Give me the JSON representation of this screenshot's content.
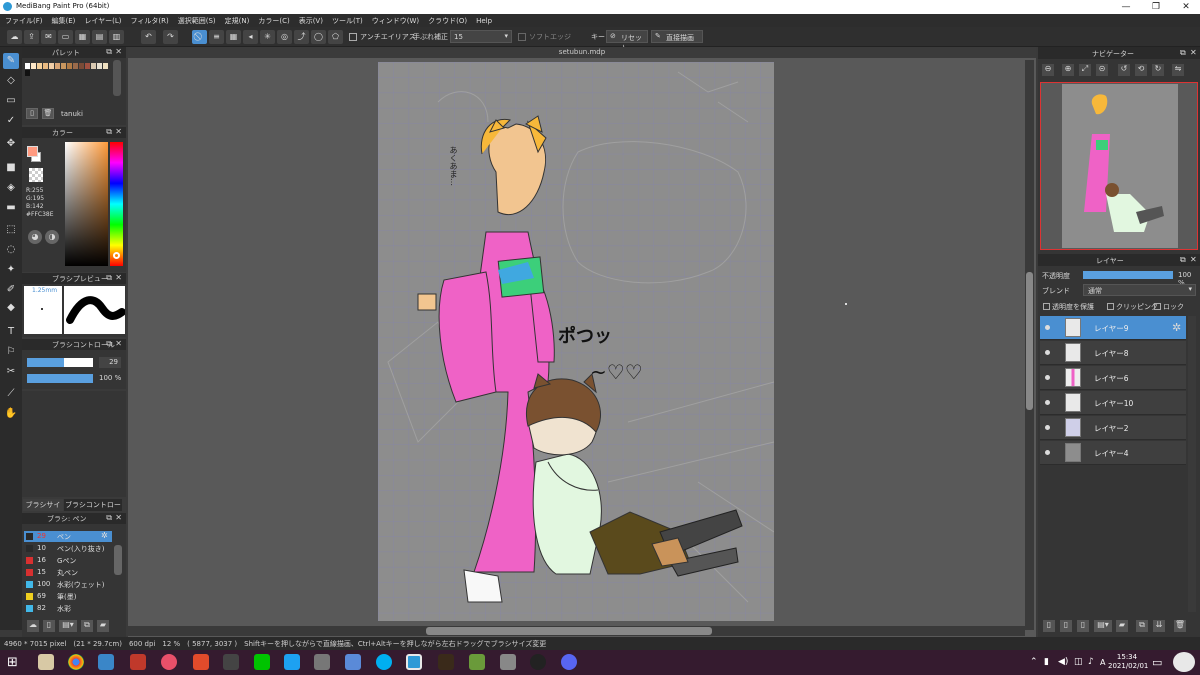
{
  "window": {
    "title": "MediBang Paint Pro (64bit)",
    "min": "—",
    "max": "❐",
    "close": "✕"
  },
  "menu": [
    "ファイル(F)",
    "編集(E)",
    "レイヤー(L)",
    "フィルタ(R)",
    "選択範囲(S)",
    "定規(N)",
    "カラー(C)",
    "表示(V)",
    "ツール(T)",
    "ウィンドウ(W)",
    "クラウド(O)",
    "Help"
  ],
  "toolbar": {
    "antialias": "アンチエイリアス",
    "stabilizer_label": "手ぶれ補正",
    "stabilizer_value": "15",
    "soft_edge": "ソフトエッジ",
    "key_label": "キー",
    "reset": "リセット",
    "direct_draw": "直接描画"
  },
  "document": {
    "tab": "setubun.mdp"
  },
  "panels": {
    "palette": {
      "title": "パレット",
      "name": "tanuki"
    },
    "color": {
      "title": "カラー",
      "r": "R:255",
      "g": "G:195",
      "b": "B:142",
      "hex": "#FFC38E"
    },
    "brush_preview": {
      "title": "ブラシプレビュー",
      "size": "1.25mm"
    },
    "brush_control": {
      "title": "ブラシコントロール",
      "size_value": "29",
      "opacity_value": "100 %"
    },
    "brush_tabs": [
      "ブラシサイズ",
      "ブラシコントロール"
    ],
    "brush_list": {
      "title": "ブラシ: ペン",
      "items": [
        {
          "size": "29",
          "name": "ペン",
          "color": "#2a2a2a",
          "selected": true
        },
        {
          "size": "10",
          "name": "ペン(入り抜き)",
          "color": "#2a2a2a"
        },
        {
          "size": "16",
          "name": "Gペン",
          "color": "#d83030"
        },
        {
          "size": "15",
          "name": "丸ペン",
          "color": "#d83030"
        },
        {
          "size": "100",
          "name": "水彩(ウェット)",
          "color": "#42b8e8"
        },
        {
          "size": "69",
          "name": "筆(墨)",
          "color": "#f0d020"
        },
        {
          "size": "82",
          "name": "水彩",
          "color": "#42b8e8"
        }
      ]
    },
    "navigator": {
      "title": "ナビゲーター"
    },
    "layer": {
      "title": "レイヤー",
      "opacity_label": "不透明度",
      "opacity_value": "100 %",
      "blend_label": "ブレンド",
      "blend_value": "通常",
      "protect": "透明度を保護",
      "clipping": "クリッピング",
      "lock": "ロック",
      "layers": [
        {
          "name": "レイヤー9",
          "selected": true
        },
        {
          "name": "レイヤー8"
        },
        {
          "name": "レイヤー6"
        },
        {
          "name": "レイヤー10"
        },
        {
          "name": "レイヤー2"
        },
        {
          "name": "レイヤー4"
        }
      ]
    }
  },
  "status": {
    "text": "4960 * 7015 pixel　(21 * 29.7cm)　600 dpi　12 %　( 5877, 3037 )　Shiftキーを押しながらで直線描画、Ctrl+Altキーを押しながら左右ドラッグでブラシサイズ変更"
  },
  "taskbar": {
    "time": "15:34",
    "date": "2021/02/01",
    "lang": "A"
  },
  "canvas_text": {
    "sfx1": "ポつッ",
    "sfx2": "~♡♡",
    "mutter": "あくあま…"
  }
}
